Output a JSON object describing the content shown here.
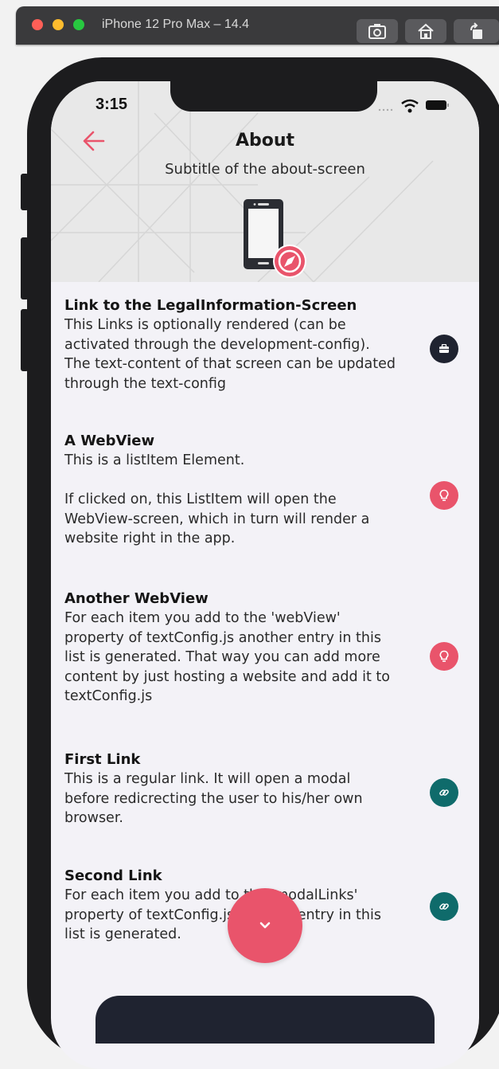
{
  "simulator": {
    "title": "iPhone 12 Pro Max – 14.4"
  },
  "status": {
    "time": "3:15"
  },
  "header": {
    "title": "About",
    "subtitle": "Subtitle of the about-screen"
  },
  "items": [
    {
      "title": "Link to the LegalInformation-Screen",
      "text": "This Links is optionally rendered (can be\nactivated through the development-config).\nThe text-content of that screen can be updated\nthrough the text-config",
      "icon": "briefcase-icon",
      "color": "#1f2330"
    },
    {
      "title": "A WebView",
      "text": "This is a listItem Element.\n\nIf clicked on, this ListItem will open the\nWebView-screen, which in turn will render a\nwebsite right in the app.",
      "icon": "lightbulb-icon",
      "color": "#e9546b"
    },
    {
      "title": "Another WebView",
      "text": "For each item you add to the 'webView'\nproperty of textConfig.js another entry in this\nlist is generated. That way you can add more\ncontent by just hosting a website and add it to\ntextConfig.js",
      "icon": "lightbulb-icon",
      "color": "#e9546b"
    },
    {
      "title": "First Link",
      "text": "This is a regular link. It will open a modal\nbefore redicrecting the user to his/her own\nbrowser.",
      "icon": "link-icon",
      "color": "#0f6b6b"
    },
    {
      "title": "Second Link",
      "text": "For each item you add to the 'modalLinks'\nproperty of textConfig.js another entry in this\nlist is generated.",
      "icon": "link-icon",
      "color": "#0f6b6b"
    }
  ],
  "colors": {
    "accent": "#e9546b",
    "dark": "#1f2330",
    "teal": "#0f6b6b"
  }
}
